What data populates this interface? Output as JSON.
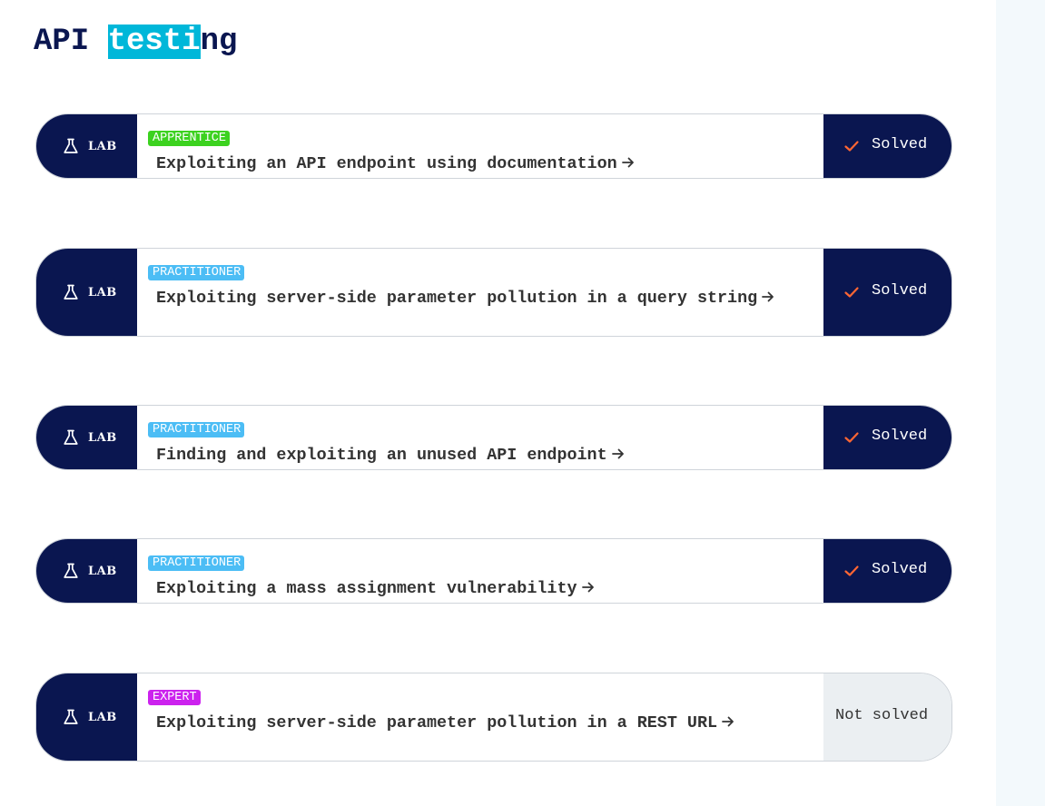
{
  "page": {
    "title_prefix": "API ",
    "title_highlight": "testi",
    "title_suffix": "ng"
  },
  "colors": {
    "navy": "#0a1650",
    "highlight": "#00b7d9",
    "apprentice": "#3cd21f",
    "practitioner": "#4cbdf5",
    "expert": "#cc22ee",
    "check": "#ff6633"
  },
  "icons": {
    "lab": "flask-icon",
    "link": "arrow-right-icon",
    "status": "check-icon"
  },
  "labs": [
    {
      "badge": "LAB",
      "level": "APPRENTICE",
      "level_color": "#3cd21f",
      "title": "Exploiting an API endpoint using documentation",
      "status": "Solved",
      "solved": true
    },
    {
      "badge": "LAB",
      "level": "PRACTITIONER",
      "level_color": "#4cbdf5",
      "title": "Exploiting server-side parameter pollution in a query string",
      "status": "Solved",
      "solved": true
    },
    {
      "badge": "LAB",
      "level": "PRACTITIONER",
      "level_color": "#4cbdf5",
      "title": "Finding and exploiting an unused API endpoint",
      "status": "Solved",
      "solved": true
    },
    {
      "badge": "LAB",
      "level": "PRACTITIONER",
      "level_color": "#4cbdf5",
      "title": "Exploiting a mass assignment vulnerability",
      "status": "Solved",
      "solved": true
    },
    {
      "badge": "LAB",
      "level": "EXPERT",
      "level_color": "#cc22ee",
      "title": "Exploiting server-side parameter pollution in a REST URL",
      "status": "Not solved",
      "solved": false
    }
  ]
}
